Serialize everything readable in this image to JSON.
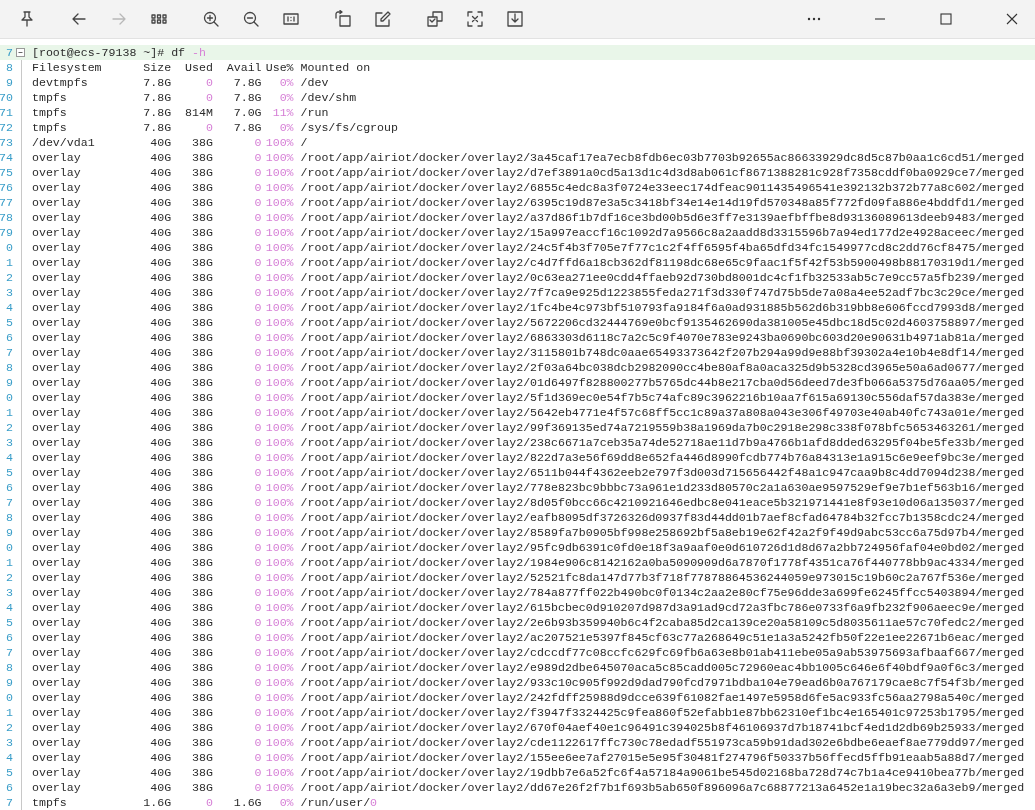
{
  "toolbar_groups": [
    [
      {
        "kind": "pin",
        "disabled": false
      }
    ],
    [
      {
        "kind": "back",
        "disabled": false
      },
      {
        "kind": "forward",
        "disabled": true
      },
      {
        "kind": "grid",
        "disabled": false
      }
    ],
    [
      {
        "kind": "zoom-in",
        "disabled": false
      },
      {
        "kind": "zoom-out",
        "disabled": false
      },
      {
        "kind": "actual-size",
        "disabled": false
      }
    ],
    [
      {
        "kind": "rotate",
        "disabled": false
      },
      {
        "kind": "edit",
        "disabled": false
      }
    ],
    [
      {
        "kind": "copy",
        "disabled": false
      },
      {
        "kind": "scan",
        "disabled": false
      },
      {
        "kind": "save",
        "disabled": false
      }
    ]
  ],
  "window_controls": [
    {
      "kind": "more"
    },
    {
      "kind": "minimize"
    },
    {
      "kind": "maximize"
    },
    {
      "kind": "close"
    }
  ],
  "terminal_lines": [
    {
      "kind": "prompt",
      "current": true,
      "line_number": "7",
      "text": "[root@ecs-79138 ~]# df ",
      "accent": "-h"
    },
    {
      "kind": "record",
      "current": false,
      "line_number": "8",
      "cells": [
        "Filesystem",
        "Size",
        "Used",
        "Avail",
        "Use%",
        "Mounted on"
      ]
    },
    {
      "kind": "record",
      "current": false,
      "line_number": "9",
      "cells": [
        "devtmpfs",
        "7.8G",
        "0",
        "7.8G",
        "0%",
        "/dev"
      ],
      "accent": [
        false,
        false,
        true,
        false,
        true,
        false
      ]
    },
    {
      "kind": "record",
      "current": false,
      "line_number": "70",
      "cells": [
        "tmpfs",
        "7.8G",
        "0",
        "7.8G",
        "0%",
        "/dev/shm"
      ],
      "accent": [
        false,
        false,
        true,
        false,
        true,
        false
      ]
    },
    {
      "kind": "record",
      "current": false,
      "line_number": "71",
      "cells": [
        "tmpfs",
        "7.8G",
        "814M",
        "7.0G",
        "11%",
        "/run"
      ],
      "accent": [
        false,
        false,
        false,
        false,
        true,
        false
      ]
    },
    {
      "kind": "record",
      "current": false,
      "line_number": "72",
      "cells": [
        "tmpfs",
        "7.8G",
        "0",
        "7.8G",
        "0%",
        "/sys/fs/cgroup"
      ],
      "accent": [
        false,
        false,
        true,
        false,
        true,
        false
      ]
    },
    {
      "kind": "record",
      "current": false,
      "line_number": "73",
      "cells": [
        "/dev/vda1",
        "40G",
        "38G",
        "0",
        "100%",
        "/"
      ],
      "accent": [
        false,
        false,
        false,
        true,
        true,
        false
      ]
    },
    {
      "kind": "record",
      "current": false,
      "line_number": "74",
      "cells": [
        "overlay",
        "40G",
        "38G",
        "0",
        "100%",
        "/root/app/airiot/docker/overlay2/3a45caf17ea7ecb8fdb6ec03b7703b92655ac86633929dc8d5c87b0aa1c6cd51/merged"
      ],
      "accent": [
        false,
        false,
        false,
        true,
        true,
        false
      ]
    },
    {
      "kind": "record",
      "current": false,
      "line_number": "75",
      "cells": [
        "overlay",
        "40G",
        "38G",
        "0",
        "100%",
        "/root/app/airiot/docker/overlay2/d7ef3891a0cd5a13d1c4d3d8ab061cf8671388281c928f7358cddf0ba0929ce7/merged"
      ],
      "accent": [
        false,
        false,
        false,
        true,
        true,
        false
      ]
    },
    {
      "kind": "record",
      "current": false,
      "line_number": "76",
      "cells": [
        "overlay",
        "40G",
        "38G",
        "0",
        "100%",
        "/root/app/airiot/docker/overlay2/6855c4edc8a3f0724e33eec174dfeac9011435496541e392132b372b77a8c602/merged"
      ],
      "accent": [
        false,
        false,
        false,
        true,
        true,
        false
      ]
    },
    {
      "kind": "record",
      "current": false,
      "line_number": "77",
      "cells": [
        "overlay",
        "40G",
        "38G",
        "0",
        "100%",
        "/root/app/airiot/docker/overlay2/6395c19d87e3a5c3418bf34e14e14d19fd570348a85f772fd09fa886e4bddfd1/merged"
      ],
      "accent": [
        false,
        false,
        false,
        true,
        true,
        false
      ]
    },
    {
      "kind": "record",
      "current": false,
      "line_number": "78",
      "cells": [
        "overlay",
        "40G",
        "38G",
        "0",
        "100%",
        "/root/app/airiot/docker/overlay2/a37d86f1b7df16ce3bd00b5d6e3ff7e3139aefbffbe8d93136089613deeb9483/merged"
      ],
      "accent": [
        false,
        false,
        false,
        true,
        true,
        false
      ]
    },
    {
      "kind": "record",
      "current": false,
      "line_number": "79",
      "cells": [
        "overlay",
        "40G",
        "38G",
        "0",
        "100%",
        "/root/app/airiot/docker/overlay2/15a997eaccf16c1092d7a9566c8a2aadd8d3315596b7a94ed177d2e4928aceec/merged"
      ],
      "accent": [
        false,
        false,
        false,
        true,
        true,
        false
      ]
    },
    {
      "kind": "record",
      "current": false,
      "line_number": "0",
      "cells": [
        "overlay",
        "40G",
        "38G",
        "0",
        "100%",
        "/root/app/airiot/docker/overlay2/24c5f4b3f705e7f77c1c2f4ff6595f4ba65dfd34fc1549977cd8c2dd76cf8475/merged"
      ],
      "accent": [
        false,
        false,
        false,
        true,
        true,
        false
      ]
    },
    {
      "kind": "record",
      "current": false,
      "line_number": "1",
      "cells": [
        "overlay",
        "40G",
        "38G",
        "0",
        "100%",
        "/root/app/airiot/docker/overlay2/c4d7ffd6a18cb362df81198dc68e65c9faac1f5f42f53b5900498b88170319d1/merged"
      ],
      "accent": [
        false,
        false,
        false,
        true,
        true,
        false
      ]
    },
    {
      "kind": "record",
      "current": false,
      "line_number": "2",
      "cells": [
        "overlay",
        "40G",
        "38G",
        "0",
        "100%",
        "/root/app/airiot/docker/overlay2/0c63ea271ee0cdd4ffaeb92d730bd8001dc4cf1fb32533ab5c7e9cc57a5fb239/merged"
      ],
      "accent": [
        false,
        false,
        false,
        true,
        true,
        false
      ]
    },
    {
      "kind": "record",
      "current": false,
      "line_number": "3",
      "cells": [
        "overlay",
        "40G",
        "38G",
        "0",
        "100%",
        "/root/app/airiot/docker/overlay2/7f7ca9e925d1223855feda271f3d330f747d75b5de7a08a4ee52adf7bc3c29ce/merged"
      ],
      "accent": [
        false,
        false,
        false,
        true,
        true,
        false
      ]
    },
    {
      "kind": "record",
      "current": false,
      "line_number": "4",
      "cells": [
        "overlay",
        "40G",
        "38G",
        "0",
        "100%",
        "/root/app/airiot/docker/overlay2/1fc4be4c973bf510793fa9184f6a0ad931885b562d6b319bb8e606fccd7993d8/merged"
      ],
      "accent": [
        false,
        false,
        false,
        true,
        true,
        false
      ]
    },
    {
      "kind": "record",
      "current": false,
      "line_number": "5",
      "cells": [
        "overlay",
        "40G",
        "38G",
        "0",
        "100%",
        "/root/app/airiot/docker/overlay2/5672206cd32444769e0bcf9135462690da381005e45dbc18d5c02d4603758897/merged"
      ],
      "accent": [
        false,
        false,
        false,
        true,
        true,
        false
      ]
    },
    {
      "kind": "record",
      "current": false,
      "line_number": "6",
      "cells": [
        "overlay",
        "40G",
        "38G",
        "0",
        "100%",
        "/root/app/airiot/docker/overlay2/6863303d6118c7a2c5c9f4070e783e9243ba0690bc603d20e90631b4971ab81a/merged"
      ],
      "accent": [
        false,
        false,
        false,
        true,
        true,
        false
      ]
    },
    {
      "kind": "record",
      "current": false,
      "line_number": "7",
      "cells": [
        "overlay",
        "40G",
        "38G",
        "0",
        "100%",
        "/root/app/airiot/docker/overlay2/3115801b748dc0aae65493373642f207b294a99d9e88bf39302a4e10b4e8df14/merged"
      ],
      "accent": [
        false,
        false,
        false,
        true,
        true,
        false
      ]
    },
    {
      "kind": "record",
      "current": false,
      "line_number": "8",
      "cells": [
        "overlay",
        "40G",
        "38G",
        "0",
        "100%",
        "/root/app/airiot/docker/overlay2/2f03a64bc038dcb2982090cc4be80af8a0aca325d9b5328cd3965e50a6ad0677/merged"
      ],
      "accent": [
        false,
        false,
        false,
        true,
        true,
        false
      ]
    },
    {
      "kind": "record",
      "current": false,
      "line_number": "9",
      "cells": [
        "overlay",
        "40G",
        "38G",
        "0",
        "100%",
        "/root/app/airiot/docker/overlay2/01d6497f828800277b5765dc44b8e217cba0d56deed7de3fb066a5375d76aa05/merged"
      ],
      "accent": [
        false,
        false,
        false,
        true,
        true,
        false
      ]
    },
    {
      "kind": "record",
      "current": false,
      "line_number": "0",
      "cells": [
        "overlay",
        "40G",
        "38G",
        "0",
        "100%",
        "/root/app/airiot/docker/overlay2/5f1d369ec0e54f7b5c74afc89c3962216b10aa7f615a69130c556daf57da383e/merged"
      ],
      "accent": [
        false,
        false,
        false,
        true,
        true,
        false
      ]
    },
    {
      "kind": "record",
      "current": false,
      "line_number": "1",
      "cells": [
        "overlay",
        "40G",
        "38G",
        "0",
        "100%",
        "/root/app/airiot/docker/overlay2/5642eb4771e4f57c68ff5cc1c89a37a808a043e306f49703e40ab40fc743a01e/merged"
      ],
      "accent": [
        false,
        false,
        false,
        true,
        true,
        false
      ]
    },
    {
      "kind": "record",
      "current": false,
      "line_number": "2",
      "cells": [
        "overlay",
        "40G",
        "38G",
        "0",
        "100%",
        "/root/app/airiot/docker/overlay2/99f369135ed74a7219559b38a1969da7b0c2918e298c338f078bfc5653463261/merged"
      ],
      "accent": [
        false,
        false,
        false,
        true,
        true,
        false
      ]
    },
    {
      "kind": "record",
      "current": false,
      "line_number": "3",
      "cells": [
        "overlay",
        "40G",
        "38G",
        "0",
        "100%",
        "/root/app/airiot/docker/overlay2/238c6671a7ceb35a74de52718ae11d7b9a4766b1afd8dded63295f04be5fe33b/merged"
      ],
      "accent": [
        false,
        false,
        false,
        true,
        true,
        false
      ]
    },
    {
      "kind": "record",
      "current": false,
      "line_number": "4",
      "cells": [
        "overlay",
        "40G",
        "38G",
        "0",
        "100%",
        "/root/app/airiot/docker/overlay2/822d7a3e56f69dd8e652fa446d8990fcdb774b76a84313e1a915c6e9eef9bc3e/merged"
      ],
      "accent": [
        false,
        false,
        false,
        true,
        true,
        false
      ]
    },
    {
      "kind": "record",
      "current": false,
      "line_number": "5",
      "cells": [
        "overlay",
        "40G",
        "38G",
        "0",
        "100%",
        "/root/app/airiot/docker/overlay2/6511b044f4362eeb2e797f3d003d715656442f48a1c947caa9b8c4dd7094d238/merged"
      ],
      "accent": [
        false,
        false,
        false,
        true,
        true,
        false
      ]
    },
    {
      "kind": "record",
      "current": false,
      "line_number": "6",
      "cells": [
        "overlay",
        "40G",
        "38G",
        "0",
        "100%",
        "/root/app/airiot/docker/overlay2/778e823bc9bbbc73a961e1d233d80570c2a1a630ae9597529ef9e7b1ef563b16/merged"
      ],
      "accent": [
        false,
        false,
        false,
        true,
        true,
        false
      ]
    },
    {
      "kind": "record",
      "current": false,
      "line_number": "7",
      "cells": [
        "overlay",
        "40G",
        "38G",
        "0",
        "100%",
        "/root/app/airiot/docker/overlay2/8d05f0bcc66c4210921646edbc8e041eace5b321971441e8f93e10d06a135037/merged"
      ],
      "accent": [
        false,
        false,
        false,
        true,
        true,
        false
      ]
    },
    {
      "kind": "record",
      "current": false,
      "line_number": "8",
      "cells": [
        "overlay",
        "40G",
        "38G",
        "0",
        "100%",
        "/root/app/airiot/docker/overlay2/eafb8095df3726326d0937f83d44dd01b7aef8cfad64784b32fcc7b1358cdc24/merged"
      ],
      "accent": [
        false,
        false,
        false,
        true,
        true,
        false
      ]
    },
    {
      "kind": "record",
      "current": false,
      "line_number": "9",
      "cells": [
        "overlay",
        "40G",
        "38G",
        "0",
        "100%",
        "/root/app/airiot/docker/overlay2/8589fa7b0905bf998e258692bf5a8eb19e62f42a2f9f49d9abc53cc6a75d97b4/merged"
      ],
      "accent": [
        false,
        false,
        false,
        true,
        true,
        false
      ]
    },
    {
      "kind": "record",
      "current": false,
      "line_number": "0",
      "cells": [
        "overlay",
        "40G",
        "38G",
        "0",
        "100%",
        "/root/app/airiot/docker/overlay2/95fc9db6391c0fd0e18f3a9aaf0e0d610726d1d8d67a2bb724956faf04e0bd02/merged"
      ],
      "accent": [
        false,
        false,
        false,
        true,
        true,
        false
      ]
    },
    {
      "kind": "record",
      "current": false,
      "line_number": "1",
      "cells": [
        "overlay",
        "40G",
        "38G",
        "0",
        "100%",
        "/root/app/airiot/docker/overlay2/1984e906c8142162a0ba5090909d6a7870f1778f4351ca76f440778bb9ac4334/merged"
      ],
      "accent": [
        false,
        false,
        false,
        true,
        true,
        false
      ]
    },
    {
      "kind": "record",
      "current": false,
      "line_number": "2",
      "cells": [
        "overlay",
        "40G",
        "38G",
        "0",
        "100%",
        "/root/app/airiot/docker/overlay2/52521fc8da147d77b3f718f77878864536244059e973015c19b60c2a767f536e/merged"
      ],
      "accent": [
        false,
        false,
        false,
        true,
        true,
        false
      ]
    },
    {
      "kind": "record",
      "current": false,
      "line_number": "3",
      "cells": [
        "overlay",
        "40G",
        "38G",
        "0",
        "100%",
        "/root/app/airiot/docker/overlay2/784a877ff022b490bc0f0134c2aa2e80cf75e96dde3a699fe6245ffcc5403894/merged"
      ],
      "accent": [
        false,
        false,
        false,
        true,
        true,
        false
      ]
    },
    {
      "kind": "record",
      "current": false,
      "line_number": "4",
      "cells": [
        "overlay",
        "40G",
        "38G",
        "0",
        "100%",
        "/root/app/airiot/docker/overlay2/615bcbec0d910207d987d3a91ad9cd72a3fbc786e0733f6a9fb232f906aeec9e/merged"
      ],
      "accent": [
        false,
        false,
        false,
        true,
        true,
        false
      ]
    },
    {
      "kind": "record",
      "current": false,
      "line_number": "5",
      "cells": [
        "overlay",
        "40G",
        "38G",
        "0",
        "100%",
        "/root/app/airiot/docker/overlay2/2e6b93b359940b6c4f2caba85d2ca139ce20a58109c5d8035611ae57c70fedc2/merged"
      ],
      "accent": [
        false,
        false,
        false,
        true,
        true,
        false
      ]
    },
    {
      "kind": "record",
      "current": false,
      "line_number": "6",
      "cells": [
        "overlay",
        "40G",
        "38G",
        "0",
        "100%",
        "/root/app/airiot/docker/overlay2/ac207521e5397f845cf63c77a268649c51e1a3a5242fb50f22e1ee22671b6eac/merged"
      ],
      "accent": [
        false,
        false,
        false,
        true,
        true,
        false
      ]
    },
    {
      "kind": "record",
      "current": false,
      "line_number": "7",
      "cells": [
        "overlay",
        "40G",
        "38G",
        "0",
        "100%",
        "/root/app/airiot/docker/overlay2/cdccdf77c08ccfc629fc69fb6a63e8b01ab411ebe05a9ab53975693afbaaf667/merged"
      ],
      "accent": [
        false,
        false,
        false,
        true,
        true,
        false
      ]
    },
    {
      "kind": "record",
      "current": false,
      "line_number": "8",
      "cells": [
        "overlay",
        "40G",
        "38G",
        "0",
        "100%",
        "/root/app/airiot/docker/overlay2/e989d2dbe645070aca5c85cadd005c72960eac4bb1005c646e6f40bdf9a0f6c3/merged"
      ],
      "accent": [
        false,
        false,
        false,
        true,
        true,
        false
      ]
    },
    {
      "kind": "record",
      "current": false,
      "line_number": "9",
      "cells": [
        "overlay",
        "40G",
        "38G",
        "0",
        "100%",
        "/root/app/airiot/docker/overlay2/933c10c905f992d9dad790fcd7971bdba104e79ead6b0a767179cae8c7f54f3b/merged"
      ],
      "accent": [
        false,
        false,
        false,
        true,
        true,
        false
      ]
    },
    {
      "kind": "record",
      "current": false,
      "line_number": "0",
      "cells": [
        "overlay",
        "40G",
        "38G",
        "0",
        "100%",
        "/root/app/airiot/docker/overlay2/242fdff25988d9dcce639f61082fae1497e5958d6fe5ac933fc56aa2798a540c/merged"
      ],
      "accent": [
        false,
        false,
        false,
        true,
        true,
        false
      ]
    },
    {
      "kind": "record",
      "current": false,
      "line_number": "1",
      "cells": [
        "overlay",
        "40G",
        "38G",
        "0",
        "100%",
        "/root/app/airiot/docker/overlay2/f3947f3324425c9fea860f52efabb1e87bb62310ef1bc4e165401c97253b1795/merged"
      ],
      "accent": [
        false,
        false,
        false,
        true,
        true,
        false
      ]
    },
    {
      "kind": "record",
      "current": false,
      "line_number": "2",
      "cells": [
        "overlay",
        "40G",
        "38G",
        "0",
        "100%",
        "/root/app/airiot/docker/overlay2/670f04aef40e1c96491c394025b8f46106937d7b18741bcf4ed1d2db69b25933/merged"
      ],
      "accent": [
        false,
        false,
        false,
        true,
        true,
        false
      ]
    },
    {
      "kind": "record",
      "current": false,
      "line_number": "3",
      "cells": [
        "overlay",
        "40G",
        "38G",
        "0",
        "100%",
        "/root/app/airiot/docker/overlay2/cde1122617ffc730c78edadf551973ca59b91dad302e6bdbe6eaef8ae779dd97/merged"
      ],
      "accent": [
        false,
        false,
        false,
        true,
        true,
        false
      ]
    },
    {
      "kind": "record",
      "current": false,
      "line_number": "4",
      "cells": [
        "overlay",
        "40G",
        "38G",
        "0",
        "100%",
        "/root/app/airiot/docker/overlay2/155ee6ee7af27015e5e95f30481f274796f50337b56ffecd5ffb91eaab5a88d7/merged"
      ],
      "accent": [
        false,
        false,
        false,
        true,
        true,
        false
      ]
    },
    {
      "kind": "record",
      "current": false,
      "line_number": "5",
      "cells": [
        "overlay",
        "40G",
        "38G",
        "0",
        "100%",
        "/root/app/airiot/docker/overlay2/19dbb7e6a52fc6f4a57184a9061be545d02168ba728d74c7b1a4ce9410bea77b/merged"
      ],
      "accent": [
        false,
        false,
        false,
        true,
        true,
        false
      ]
    },
    {
      "kind": "record",
      "current": false,
      "line_number": "6",
      "cells": [
        "overlay",
        "40G",
        "38G",
        "0",
        "100%",
        "/root/app/airiot/docker/overlay2/dd67e26f2f7b1f693b5ab650f896096a7c68877213a6452e1a19bec32a6a3eb9/merged"
      ],
      "accent": [
        false,
        false,
        false,
        true,
        true,
        false
      ]
    },
    {
      "kind": "record",
      "current": false,
      "line_number": "7",
      "cells": [
        "tmpfs",
        "1.6G",
        "0",
        "1.6G",
        "0%",
        "/run/user/"
      ],
      "accent": [
        false,
        false,
        true,
        false,
        true,
        false
      ],
      "tail": "0"
    }
  ]
}
